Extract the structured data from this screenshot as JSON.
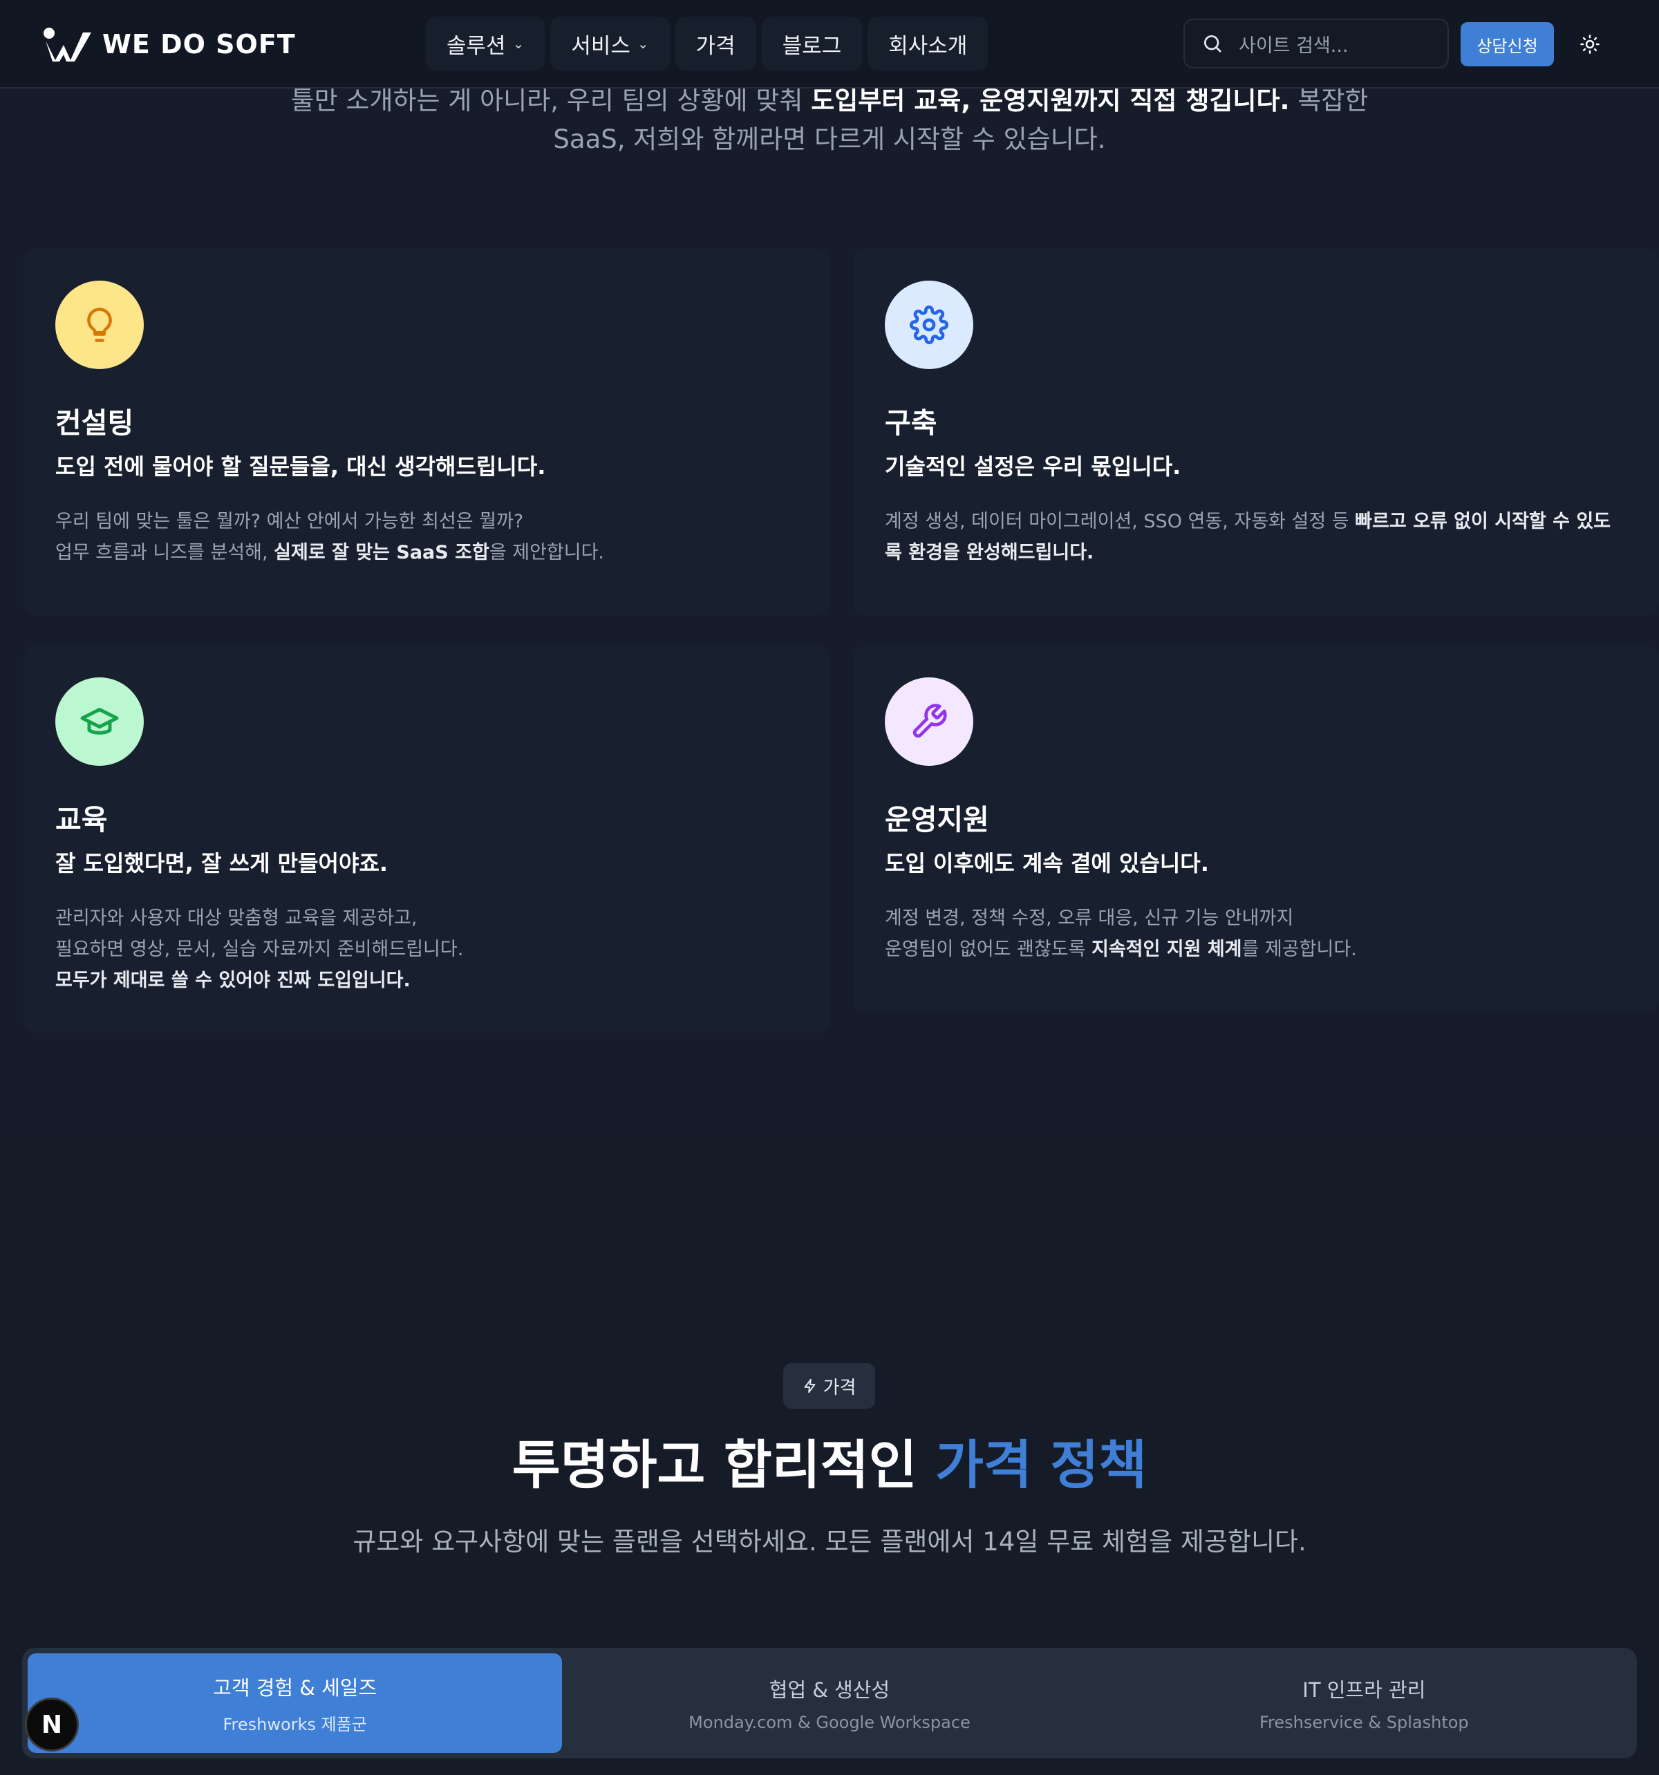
{
  "header": {
    "logo_text": "WE DO SOFT",
    "nav": [
      {
        "label": "솔루션",
        "has_dropdown": true
      },
      {
        "label": "서비스",
        "has_dropdown": true
      },
      {
        "label": "가격",
        "has_dropdown": false
      },
      {
        "label": "블로그",
        "has_dropdown": false
      },
      {
        "label": "회사소개",
        "has_dropdown": false
      }
    ],
    "search_placeholder": "사이트 검색...",
    "cta_label": "상담신청",
    "theme_icon": "sun-icon"
  },
  "intro": {
    "line1_a": "툴만 소개하는 게 아니라, 우리 팀의 상황에 맞춰 ",
    "line1_b": "도입부터 교육, 운영지원까지 직접 챙깁니다.",
    "line1_c": " 복잡한",
    "line2": "SaaS, 저희와 함께라면 다르게 시작할 수 있습니다."
  },
  "cards": [
    {
      "icon": "lightbulb-icon",
      "title": "컨설팅",
      "tagline": "도입 전에 물어야 할 질문들을, 대신 생각해드립니다.",
      "desc_1": "우리 팀에 맞는 툴은 뭘까? 예산 안에서 가능한 최선은 뭘까?",
      "desc_2a": "업무 흐름과 니즈를 분석해, ",
      "desc_2b": "실제로 잘 맞는 SaaS 조합",
      "desc_2c": "을 제안합니다."
    },
    {
      "icon": "gear-icon",
      "title": "구축",
      "tagline": "기술적인 설정은 우리 몫입니다.",
      "desc_1a": "계정 생성, 데이터 마이그레이션, SSO 연동, 자동화 설정 등 ",
      "desc_1b": "빠르고 오류 없이 시작할 수 있도",
      "desc_2": "록 환경을 완성해드립니다."
    },
    {
      "icon": "graduation-cap-icon",
      "title": "교육",
      "tagline": "잘 도입했다면, 잘 쓰게 만들어야죠.",
      "desc_1": "관리자와 사용자 대상 맞춤형 교육을 제공하고,",
      "desc_2": "필요하면 영상, 문서, 실습 자료까지 준비해드립니다.",
      "desc_3": "모두가 제대로 쓸 수 있어야 진짜 도입입니다."
    },
    {
      "icon": "wrench-icon",
      "title": "운영지원",
      "tagline": "도입 이후에도 계속 곁에 있습니다.",
      "desc_1": "계정 변경, 정책 수정, 오류 대응, 신규 기능 안내까지",
      "desc_2a": "운영팀이 없어도 괜찮도록 ",
      "desc_2b": "지속적인 지원 체계",
      "desc_2c": "를 제공합니다."
    }
  ],
  "pricing": {
    "badge_label": "가격",
    "title_a": "투명하고 합리적인 ",
    "title_b": "가격 정책",
    "subtitle": "규모와 요구사항에 맞는 플랜을 선택하세요. 모든 플랜에서 14일 무료 체험을 제공합니다.",
    "tabs": [
      {
        "label": "고객 경험 & 세일즈",
        "sub": "Freshworks 제품군",
        "active": true
      },
      {
        "label": "협업 & 생산성",
        "sub": "Monday.com & Google Workspace",
        "active": false
      },
      {
        "label": "IT 인프라 관리",
        "sub": "Freshservice & Splashtop",
        "active": false
      }
    ]
  },
  "floating_badge": "N",
  "colors": {
    "accent": "#3f7fd6",
    "background": "#161c29",
    "card": "#182030"
  }
}
